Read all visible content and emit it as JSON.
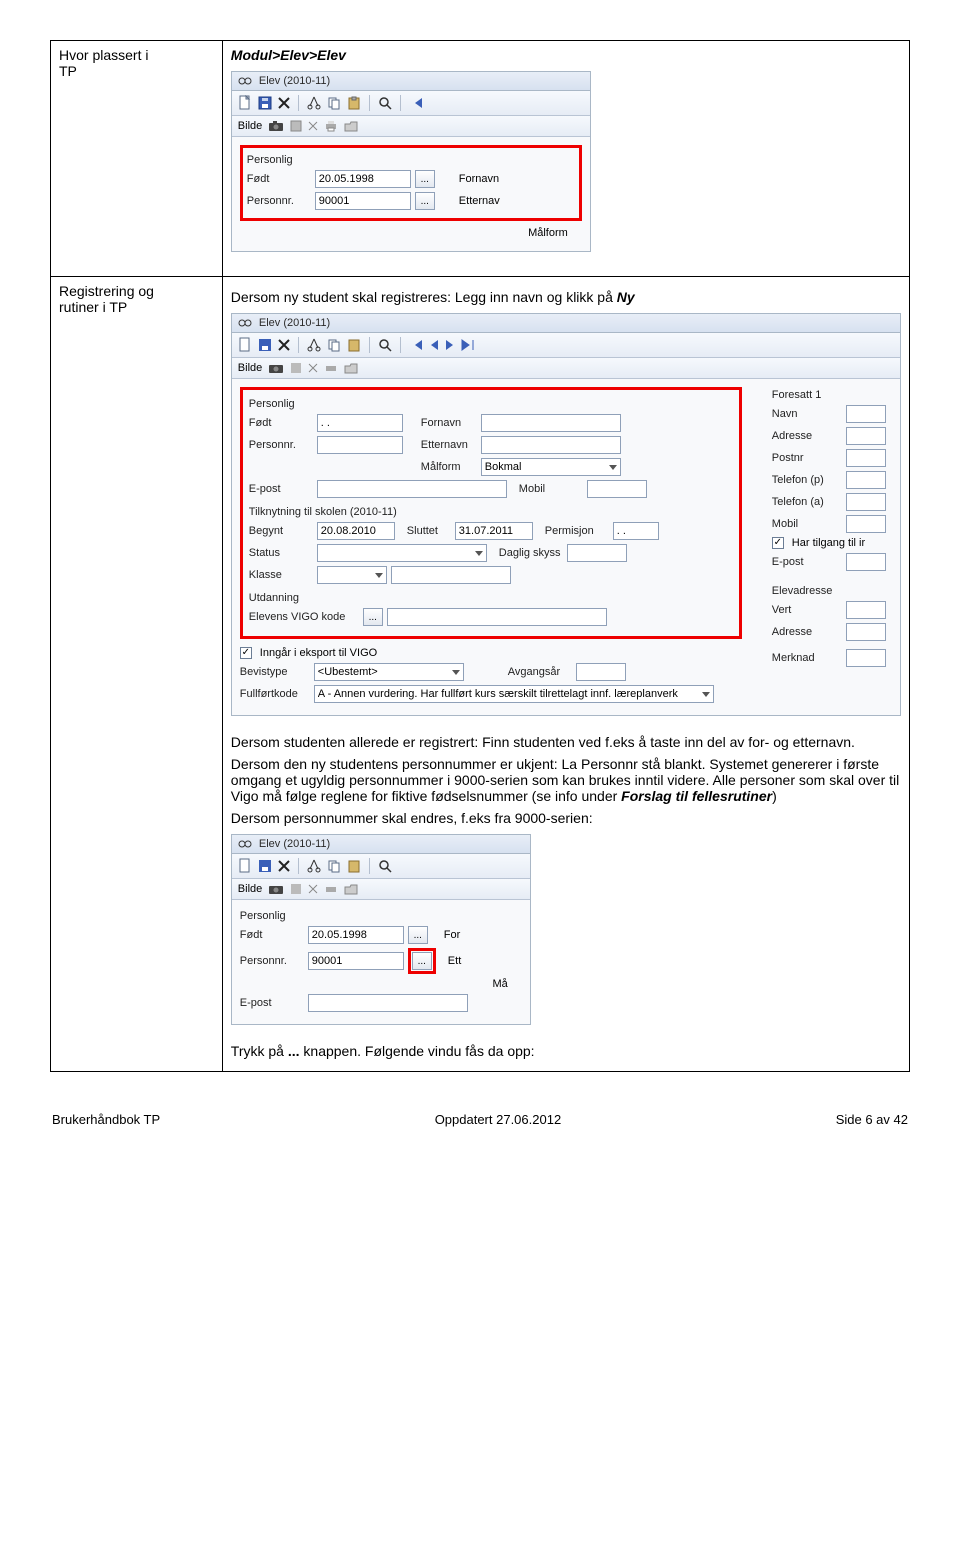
{
  "table": {
    "r1_left": "Hvor plassert i\nTP",
    "r1_right_bold": "Modul>Elev>Elev",
    "r2_left": "Registrering og\nrutiner i TP",
    "r2_p1": "Dersom ny student skal registreres: Legg inn navn og klikk på ",
    "r2_p1_bold": "Ny",
    "r2_p2": "Dersom studenten allerede er registrert: Finn studenten ved f.eks å taste inn del av for- og etternavn.",
    "r2_p3": "Dersom den ny studentens personnummer er ukjent: La Personnr stå blankt. Systemet genererer i første omgang et ugyldig personnummer i 9000-serien som kan brukes inntil videre. Alle personer som skal over til Vigo må følge reglene for fiktive fødselsnummer (se info under ",
    "r2_p3_bold": "Forslag til fellesrutiner",
    "r2_p3_tail": ")",
    "r2_p4": "Dersom personnummer skal endres, f.eks fra 9000-serien:",
    "r2_p5_a": "Trykk på ",
    "r2_p5_b": "...",
    "r2_p5_c": " knappen. Følgende vindu fås da opp:"
  },
  "ss1": {
    "title": "Elev (2010-11)",
    "bilde": "Bilde",
    "personlig": "Personlig",
    "fodt_lbl": "Født",
    "fodt_val": "20.05.1998",
    "personnr_lbl": "Personnr.",
    "personnr_val": "90001",
    "fornavn": "Fornavn",
    "etternav": "Etternav",
    "malform": "Målform"
  },
  "ss2": {
    "title": "Elev (2010-11)",
    "bilde": "Bilde",
    "personlig": "Personlig",
    "fodt_lbl": "Født",
    "fodt_val": ". .",
    "personnr_lbl": "Personnr.",
    "fornavn": "Fornavn",
    "etternavn": "Etternavn",
    "malform_lbl": "Målform",
    "malform_val": "Bokmal",
    "epost": "E-post",
    "mobil": "Mobil",
    "tilknytning": "Tilknytning til skolen (2010-11)",
    "begynt_lbl": "Begynt",
    "begynt_val": "20.08.2010",
    "sluttet_lbl": "Sluttet",
    "sluttet_val": "31.07.2011",
    "permisjon_lbl": "Permisjon",
    "permisjon_val": ". .",
    "status_lbl": "Status",
    "daglig_lbl": "Daglig skyss",
    "klasse_lbl": "Klasse",
    "utdanning": "Utdanning",
    "vigo_lbl": "Elevens VIGO kode",
    "foresatt": "Foresatt 1",
    "navn": "Navn",
    "adresse": "Adresse",
    "postnr": "Postnr",
    "telefon_p": "Telefon (p)",
    "telefon_a": "Telefon (a)",
    "har_tilgang": "Har tilgang til ir",
    "elevadresse": "Elevadresse",
    "vert": "Vert",
    "inngar": "Inngår i eksport til VIGO",
    "bevistype_lbl": "Bevistype",
    "bevistype_val": "<Ubestemt>",
    "avgangsar": "Avgangsår",
    "fullfort_lbl": "Fullførtkode",
    "fullfort_val": "A - Annen vurdering. Har fullført kurs særskilt tilrettelagt innf. læreplanverk",
    "merknad": "Merknad"
  },
  "ss3": {
    "title": "Elev (2010-11)",
    "bilde": "Bilde",
    "personlig": "Personlig",
    "fodt_lbl": "Født",
    "fodt_val": "20.05.1998",
    "personnr_lbl": "Personnr.",
    "personnr_val": "90001",
    "epost": "E-post",
    "for": "For",
    "ett": "Ett",
    "ma": "Må"
  },
  "footer": {
    "left": "Brukerhåndbok TP",
    "mid": "Oppdatert  27.06.2012",
    "right": "Side 6  av 42"
  },
  "icons": {
    "new": "new-file-icon",
    "save": "save-icon",
    "delete": "delete-icon",
    "cut": "cut-icon",
    "copy": "copy-icon",
    "paste": "paste-icon",
    "search": "search-icon",
    "first": "first-icon",
    "prev": "prev-icon",
    "next": "next-icon",
    "last": "last-icon",
    "camera": "camera-icon",
    "print": "print-icon",
    "open": "open-icon",
    "glasses": "glasses-icon"
  }
}
